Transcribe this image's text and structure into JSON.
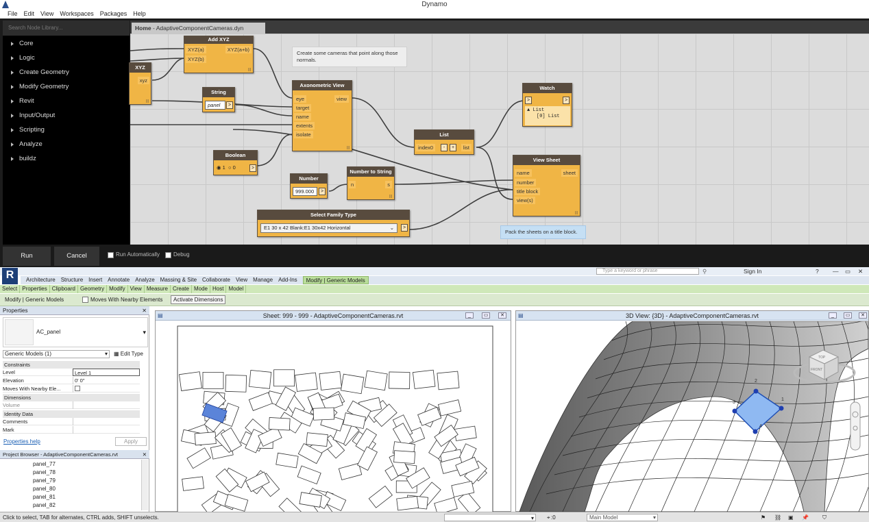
{
  "dynamo": {
    "title": "Dynamo",
    "menu": [
      "File",
      "Edit",
      "View",
      "Workspaces",
      "Packages",
      "Help"
    ],
    "search_placeholder": "Search Node Library...",
    "library": [
      "Core",
      "Logic",
      "Create Geometry",
      "Modify Geometry",
      "Revit",
      "Input/Output",
      "Scripting",
      "Analyze",
      "buildz"
    ],
    "tab": {
      "home": "Home",
      "file": "- AdaptiveComponentCameras.dyn"
    },
    "nodes": {
      "xyz": {
        "title": "XYZ",
        "out": "xyz"
      },
      "add": {
        "title": "Add XYZ",
        "in1": "XYZ(a)",
        "in2": "XYZ(b)",
        "out": "XYZ(a+b)"
      },
      "string": {
        "title": "String",
        "value": "panel"
      },
      "axon": {
        "title": "Axonometric View",
        "inputs": [
          "eye",
          "target",
          "name",
          "extents",
          "isolate"
        ],
        "out": "view"
      },
      "boolean": {
        "title": "Boolean",
        "opt1": "1",
        "opt2": "0"
      },
      "number": {
        "title": "Number",
        "value": "999.000"
      },
      "n2s": {
        "title": "Number to String",
        "in": "n",
        "out": "s"
      },
      "list": {
        "title": "List",
        "in": "index0",
        "minus": "-",
        "plus": "+",
        "out": "list"
      },
      "watch": {
        "title": "Watch",
        "line1": "List",
        "line2": "[0] List"
      },
      "viewsheet": {
        "title": "View Sheet",
        "inputs": [
          "name",
          "number",
          "title block",
          "view(s)"
        ],
        "out": "sheet"
      },
      "family": {
        "title": "Select Family Type",
        "value": "E1 30 x 42 Blank:E1 30x42 Horizontal"
      }
    },
    "notes": {
      "cameras": "Create some cameras that point along those normals.",
      "sheets": "Pack the sheets on a title block."
    },
    "run_label": "Run",
    "cancel_label": "Cancel",
    "run_auto_label": "Run Automatically",
    "debug_label": "Debug",
    "accent_color": "#f0b545"
  },
  "revit": {
    "ribbon_tabs": [
      "Architecture",
      "Structure",
      "Insert",
      "Annotate",
      "Analyze",
      "Massing & Site",
      "Collaborate",
      "View",
      "Manage",
      "Add-Ins",
      "Modify | Generic Models"
    ],
    "panels": [
      "Select",
      "Properties",
      "Clipboard",
      "Geometry",
      "Modify",
      "View",
      "Measure",
      "Create",
      "Mode",
      "Host",
      "Model"
    ],
    "context": {
      "label": "Modify | Generic Models",
      "moves": "Moves With Nearby Elements",
      "activate": "Activate Dimensions"
    },
    "search_placeholder": "Type a keyword or phrase",
    "sign_in": "Sign In",
    "properties": {
      "title": "Properties",
      "type_name": "AC_panel",
      "selector": "Generic Models (1)",
      "edit_type": "Edit Type",
      "sections": {
        "constraints": "Constraints",
        "dimensions": "Dimensions",
        "identity": "Identity Data"
      },
      "rows": {
        "level_k": "Level",
        "level_v": "Level 1",
        "elev_k": "Elevation",
        "elev_v": "0' 0\"",
        "moves_k": "Moves With Nearby Ele...",
        "volume_k": "Volume",
        "comments_k": "Comments",
        "mark_k": "Mark"
      },
      "help": "Properties help",
      "apply": "Apply"
    },
    "browser": {
      "title": "Project Browser - AdaptiveComponentCameras.rvt",
      "items": [
        "panel_77",
        "panel_78",
        "panel_79",
        "panel_80",
        "panel_81",
        "panel_82"
      ]
    },
    "sheet_view_title": "Sheet: 999 - 999 - AdaptiveComponentCameras.rvt",
    "view3d_title": "3D View: {3D} - AdaptiveComponentCameras.rvt",
    "viewcube": {
      "top": "TOP",
      "front": "FRONT"
    },
    "points": [
      "1",
      "2",
      "3",
      "4"
    ],
    "status": "Click to select, TAB for alternates, CTRL adds, SHIFT unselects.",
    "status_count": ":0",
    "model": "Main Model"
  }
}
